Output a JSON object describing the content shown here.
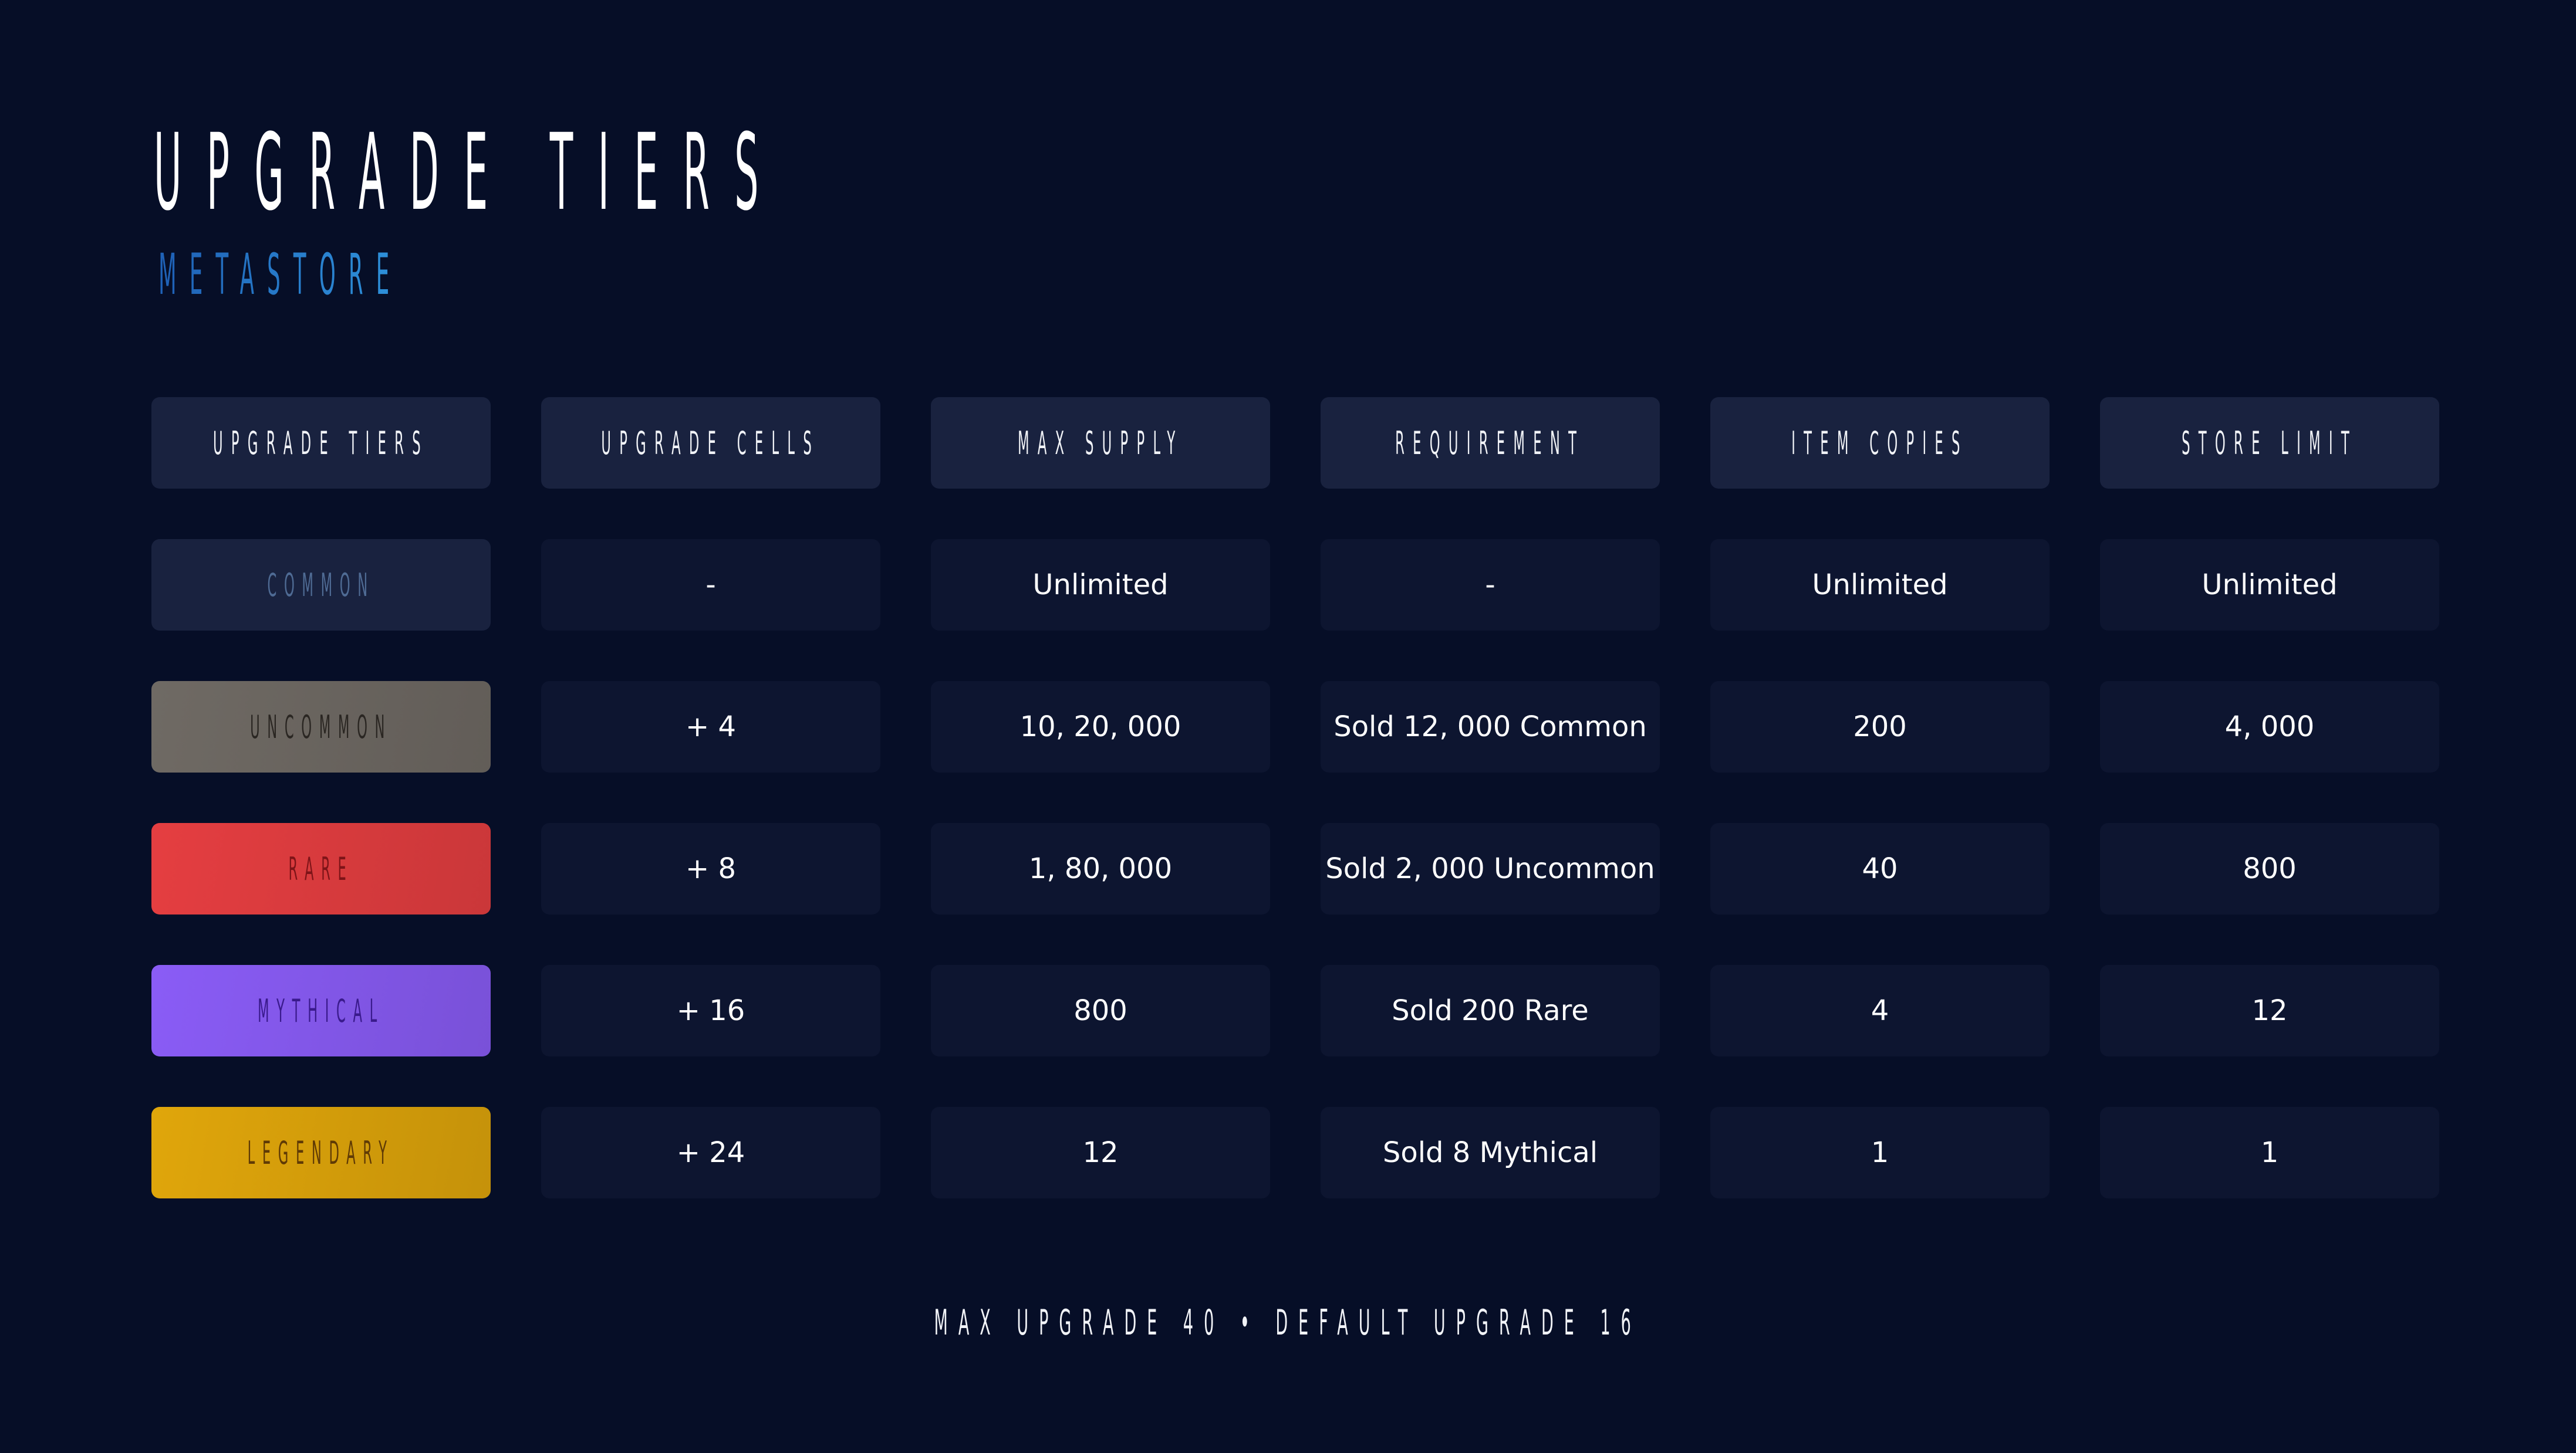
{
  "title": "UPGRADE TIERS",
  "subtitle": "METASTORE",
  "colors": {
    "background": "#060e27",
    "header_cell": "#19223f",
    "data_cell": "#0d1530",
    "subtitle_gradient": [
      "#1f62b7",
      "#2d8ed8"
    ]
  },
  "table": {
    "headers": [
      "UPGRADE TIERS",
      "UPGRADE CELLS",
      "MAX SUPPLY",
      "REQUIREMENT",
      "ITEM COPIES",
      "STORE LIMIT"
    ],
    "rows": [
      {
        "tier": "COMMON",
        "tier_colors": {
          "background": "#19223f",
          "text": "#4f6b94"
        },
        "values": [
          "-",
          "Unlimited",
          "-",
          "Unlimited",
          "Unlimited"
        ]
      },
      {
        "tier": "UNCOMMON",
        "tier_colors": {
          "background": "#6f6a64",
          "text": "#2a2622"
        },
        "values": [
          "+ 4",
          "10, 20, 000",
          "Sold 12, 000 Common",
          "200",
          "4, 000"
        ]
      },
      {
        "tier": "RARE",
        "tier_colors": {
          "background": "#e53e41",
          "text": "#7e1418"
        },
        "values": [
          "+ 8",
          "1, 80, 000",
          "Sold 2, 000 Uncommon",
          "40",
          "800"
        ]
      },
      {
        "tier": "MYTHICAL",
        "tier_colors": {
          "background": "#8a5cf6",
          "text": "#3a1a8c"
        },
        "values": [
          "+ 16",
          "800",
          "Sold 200 Rare",
          "4",
          "12"
        ]
      },
      {
        "tier": "LEGENDARY",
        "tier_colors": {
          "background": "#e0a60b",
          "text": "#5f3a05"
        },
        "values": [
          "+ 24",
          "12",
          "Sold 8 Mythical",
          "1",
          "1"
        ]
      }
    ]
  },
  "footer": "MAX UPGRADE 40 • DEFAULT UPGRADE 16"
}
